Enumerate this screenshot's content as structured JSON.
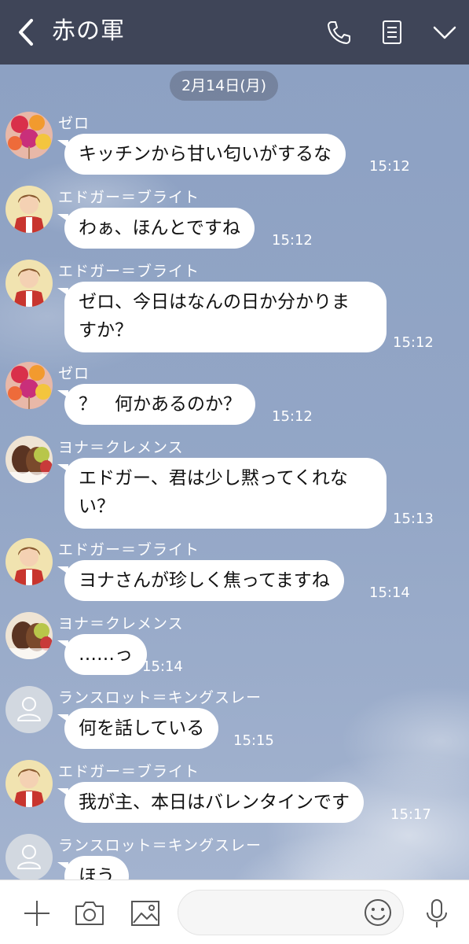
{
  "header": {
    "title": "赤の軍",
    "icons": [
      "back-icon",
      "phone-icon",
      "notes-icon",
      "chevron-down-icon"
    ]
  },
  "chat": {
    "date": "2月14日(月)",
    "messages": [
      {
        "sender": "ゼロ",
        "avatar": "zero-avatar",
        "text": "キッチンから甘い匂いがするな",
        "time": "15:12"
      },
      {
        "sender": "エドガー＝ブライト",
        "avatar": "edgar-avatar",
        "text": "わぁ、ほんとですね",
        "time": "15:12"
      },
      {
        "sender": "エドガー＝ブライト",
        "avatar": "edgar-avatar",
        "text_line1": "ゼロ、今日はなんの日か分かりま",
        "text_line2": "すか？",
        "time": "15:12"
      },
      {
        "sender": "ゼロ",
        "avatar": "zero-avatar",
        "text": "？　何かあるのか？",
        "time": "15:12"
      },
      {
        "sender": "ヨナ＝クレメンス",
        "avatar": "yona-avatar",
        "text_line1": "エドガー、君は少し黙ってくれな",
        "text_line2": "い？",
        "time": "15:13"
      },
      {
        "sender": "エドガー＝ブライト",
        "avatar": "edgar-avatar",
        "text": "ヨナさんが珍しく焦ってますね",
        "time": "15:14"
      },
      {
        "sender": "ヨナ＝クレメンス",
        "avatar": "yona-avatar",
        "text": "……っ",
        "time": "15:14"
      },
      {
        "sender": "ランスロット＝キングスレー",
        "avatar": "default-avatar",
        "text": "何を話している",
        "time": "15:15"
      },
      {
        "sender": "エドガー＝ブライト",
        "avatar": "edgar-avatar",
        "text": "我が主、本日はバレンタインです",
        "time": "15:17"
      },
      {
        "sender": "ランスロット＝キングスレー",
        "avatar": "default-avatar",
        "text": "ほう",
        "time": ""
      }
    ]
  },
  "input": {
    "placeholder": "",
    "icons": [
      "plus-icon",
      "camera-icon",
      "image-icon",
      "emoji-icon",
      "microphone-icon"
    ]
  },
  "colors": {
    "header_bg": "#3f4558",
    "chat_bg": "#8fa3c4",
    "bubble": "#ffffff"
  }
}
